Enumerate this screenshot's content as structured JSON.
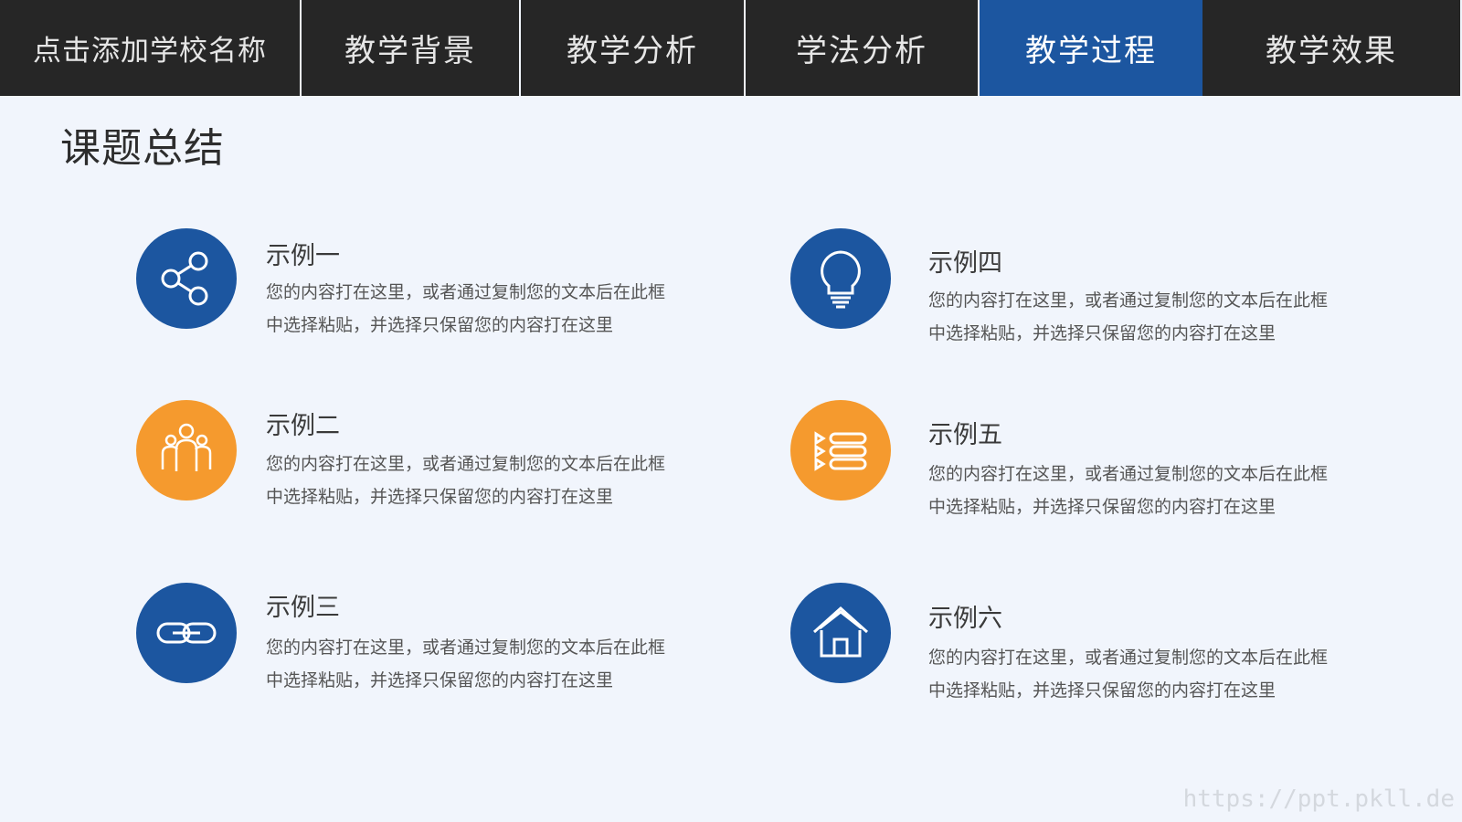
{
  "nav": {
    "school": "点击添加学校名称",
    "tabs": [
      {
        "label": "教学背景"
      },
      {
        "label": "教学分析"
      },
      {
        "label": "学法分析"
      },
      {
        "label": "教学过程",
        "active": true
      },
      {
        "label": "教学效果"
      }
    ]
  },
  "page": {
    "title": "课题总结"
  },
  "items": [
    {
      "title": "示例一",
      "desc": "您的内容打在这里，或者通过复制您的文本后在此框中选择粘贴，并选择只保留您的内容打在这里",
      "icon": "share-icon",
      "color": "#1c56a0"
    },
    {
      "title": "示例二",
      "desc": "您的内容打在这里，或者通过复制您的文本后在此框中选择粘贴，并选择只保留您的内容打在这里",
      "icon": "group-icon",
      "color": "#f59a2e"
    },
    {
      "title": "示例三",
      "desc": "您的内容打在这里，或者通过复制您的文本后在此框中选择粘贴，并选择只保留您的内容打在这里",
      "icon": "link-icon",
      "color": "#1c56a0"
    },
    {
      "title": "示例四",
      "desc": "您的内容打在这里，或者通过复制您的文本后在此框中选择粘贴，并选择只保留您的内容打在这里",
      "icon": "lightbulb-icon",
      "color": "#1c56a0"
    },
    {
      "title": "示例五",
      "desc": "您的内容打在这里，或者通过复制您的文本后在此框中选择粘贴，并选择只保留您的内容打在这里",
      "icon": "list-icon",
      "color": "#f59a2e"
    },
    {
      "title": "示例六",
      "desc": "您的内容打在这里，或者通过复制您的文本后在此框中选择粘贴，并选择只保留您的内容打在这里",
      "icon": "home-icon",
      "color": "#1c56a0"
    }
  ],
  "watermark": "https://ppt.pkll.de"
}
